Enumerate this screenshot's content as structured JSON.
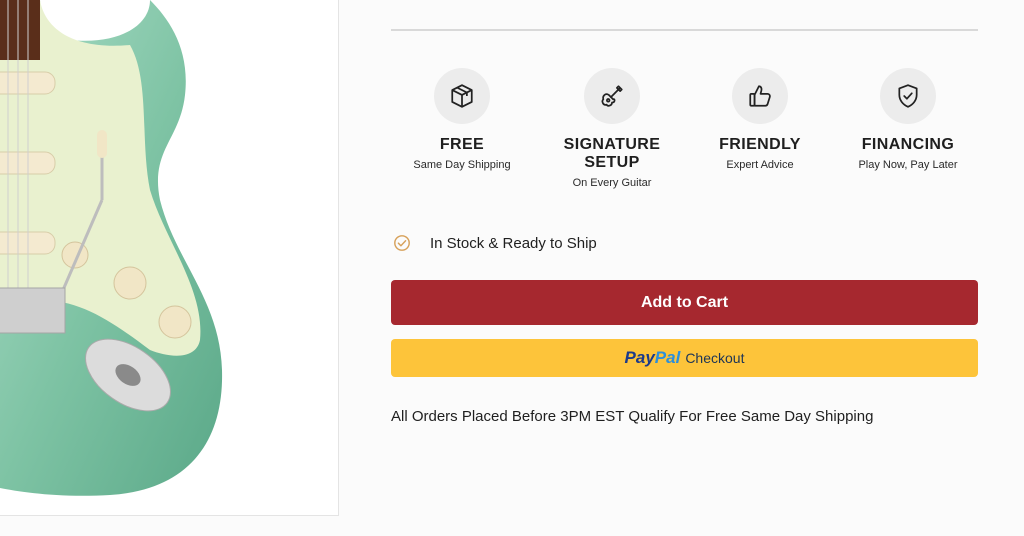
{
  "colors": {
    "accent_red": "#a6282f",
    "paypal_yellow": "#fdc43a",
    "check_orange": "#d7a15a",
    "guitar_green": "#7fc3a5",
    "pickguard": "#e9f1cf"
  },
  "features": [
    {
      "icon": "box-icon",
      "title": "FREE",
      "subtitle": "Same Day Shipping"
    },
    {
      "icon": "guitar-icon",
      "title": "SIGNATURE SETUP",
      "subtitle": "On Every Guitar"
    },
    {
      "icon": "thumbs-up-icon",
      "title": "FRIENDLY",
      "subtitle": "Expert Advice"
    },
    {
      "icon": "shield-check-icon",
      "title": "FINANCING",
      "subtitle": "Play Now, Pay Later"
    }
  ],
  "stock": {
    "icon": "check-circle-icon",
    "text": "In Stock & Ready to Ship"
  },
  "cart": {
    "label": "Add to Cart"
  },
  "paypal": {
    "brand_pay": "Pay",
    "brand_pal": "Pal",
    "label": "Checkout"
  },
  "shipping_note": "All Orders Placed Before 3PM EST Qualify For Free Same Day Shipping"
}
